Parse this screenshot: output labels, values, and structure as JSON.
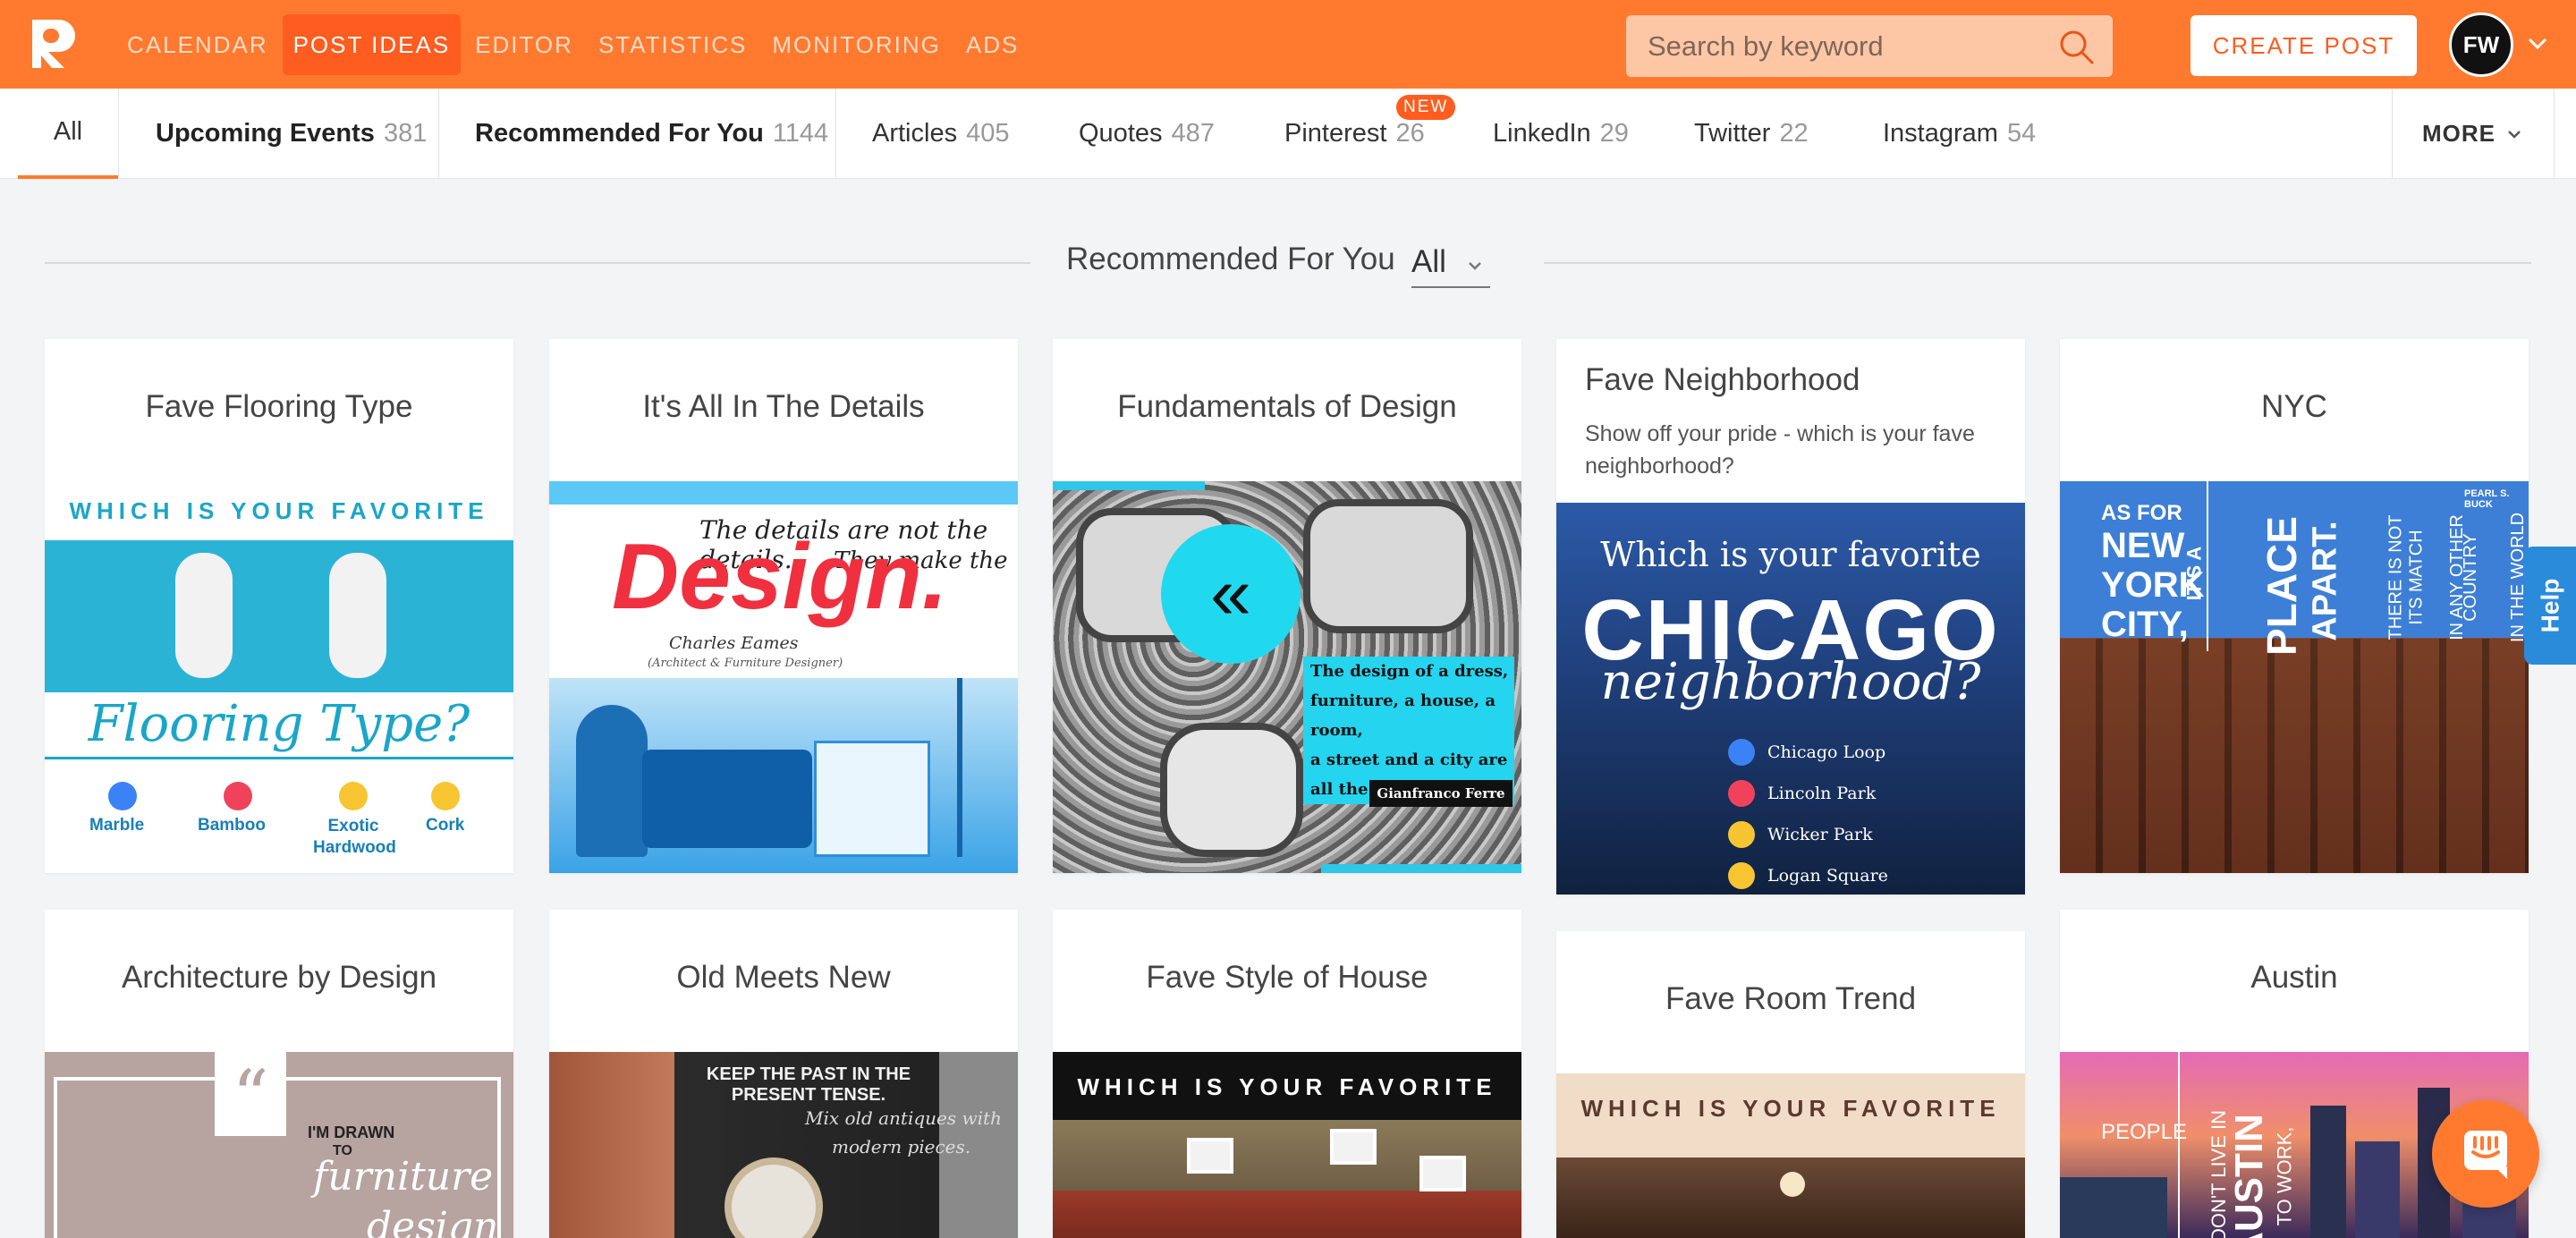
{
  "header": {
    "logo_letter": "R",
    "nav": [
      "CALENDAR",
      "POST IDEAS",
      "EDITOR",
      "STATISTICS",
      "MONITORING",
      "ADS"
    ],
    "active_nav": "POST IDEAS",
    "search_placeholder": "Search by keyword",
    "create_label": "CREATE POST",
    "avatar_text": "FW",
    "colors": {
      "brand": "#ff7a2f",
      "active": "#ff5c1f",
      "help": "#2a8bdb"
    }
  },
  "tabs": {
    "all": "All",
    "items": [
      {
        "label": "Upcoming Events",
        "count": "381"
      },
      {
        "label": "Recommended For You",
        "count": "1144"
      },
      {
        "label": "Articles",
        "count": "405"
      },
      {
        "label": "Quotes",
        "count": "487"
      },
      {
        "label": "Pinterest",
        "count": "26"
      },
      {
        "label": "LinkedIn",
        "count": "29"
      },
      {
        "label": "Twitter",
        "count": "22"
      },
      {
        "label": "Instagram",
        "count": "54"
      }
    ],
    "new_badge": "NEW",
    "more": "MORE"
  },
  "section": {
    "title": "Recommended For You",
    "filter": "All"
  },
  "cards": [
    {
      "title": "Fave Flooring Type",
      "img": {
        "banner": "WHICH IS YOUR FAVORITE",
        "script": "Flooring Type?",
        "options": [
          "Marble",
          "Bamboo",
          "Exotic Hardwood",
          "Cork"
        ]
      }
    },
    {
      "title": "It's All In The Details",
      "img": {
        "quote1": "The details are not the details.",
        "quote2": "They make the",
        "big": "Design.",
        "author": "Charles Eames",
        "role": "(Architect & Furniture Designer)"
      }
    },
    {
      "title": "Fundamentals of Design",
      "img": {
        "lines": [
          "The design of a dress,",
          "furniture, a house, a room,",
          "a street and a city are",
          "all the same process."
        ],
        "author": "Gianfranco Ferre"
      }
    },
    {
      "title": "Fave Neighborhood",
      "desc": "Show off your pride - which is your fave neighborhood?",
      "img": {
        "top": "Which is your favorite",
        "big": "CHICAGO",
        "script": "neighborhood?",
        "options": [
          "Chicago Loop",
          "Lincoln Park",
          "Wicker Park",
          "Logan Square"
        ]
      }
    },
    {
      "title": "NYC",
      "img": {
        "col1": [
          "AS FOR",
          "NEW",
          "YORK",
          "CITY,"
        ],
        "col2": [
          "IT'S A",
          "PLACE",
          "APART."
        ],
        "col3": [
          "THERE IS NOT",
          "ITS MATCH",
          "IN ANY OTHER",
          "COUNTRY",
          "IN THE WORLD"
        ],
        "credit": "PEARL S. BUCK"
      }
    },
    {
      "title": "Architecture by Design",
      "img": {
        "line1": "I'M DRAWN",
        "line2": "TO",
        "script": "furniture",
        "script2": "design"
      }
    },
    {
      "title": "Old Meets New",
      "img": {
        "line1": "KEEP THE PAST IN THE PRESENT TENSE.",
        "line2": "Mix old antiques with",
        "line3": "modern pieces."
      }
    },
    {
      "title": "Fave Style of House",
      "img": {
        "banner": "WHICH IS YOUR FAVORITE"
      }
    },
    {
      "title": "Fave Room Trend",
      "img": {
        "banner": "WHICH IS YOUR FAVORITE"
      }
    },
    {
      "title": "Austin",
      "img": {
        "line1": "PEOPLE",
        "line2": "DON'T LIVE IN",
        "big": "AUSTIN",
        "line3": "TO WORK,"
      }
    }
  ],
  "help": "Help"
}
